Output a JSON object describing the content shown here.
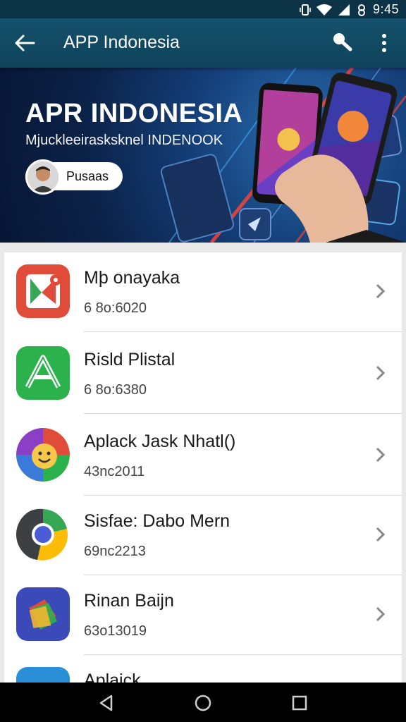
{
  "status_bar": {
    "time": "9:45",
    "icons": [
      "vibrate-icon",
      "wifi-icon",
      "signal-icon",
      "data-icon"
    ]
  },
  "app_bar": {
    "title": "APP Indonesia",
    "icons": [
      "back-arrow-icon",
      "search-icon",
      "more-vert-icon"
    ]
  },
  "banner": {
    "title": "APR INDONESIA",
    "subtitle": "Mjuckleeirasksknel INDENOOK",
    "button_label": "Pusaas",
    "colors": {
      "background": "#0b2146",
      "accent_line": "#e8433a"
    }
  },
  "apps": [
    {
      "name": "Mþ onayaka",
      "sub": "6 8o:6020",
      "icon": "maps-icon",
      "icon_color": "#e04b3a"
    },
    {
      "name": "Risld Plistal",
      "sub": "6 8o:6380",
      "icon": "a-logo-icon",
      "icon_color": "#2bb24c"
    },
    {
      "name": "Aplack Jask Nhatl()",
      "sub": "43nc2011",
      "icon": "emoji-chat-icon",
      "icon_color": "#f2b632"
    },
    {
      "name": "Sisfae: Dabo Mern",
      "sub": "69nc2213",
      "icon": "chrome-icon",
      "icon_color": "#4285f4"
    },
    {
      "name": "Rinan Baijn",
      "sub": "63o13019",
      "icon": "layers-icon",
      "icon_color": "#3a4ab8"
    },
    {
      "name": "Aplaick",
      "sub": "",
      "icon": "people-photo-icon",
      "icon_color": "#2a8fd6"
    }
  ],
  "nav_bar": {
    "icons": [
      "back-triangle-icon",
      "home-circle-icon",
      "recents-square-icon"
    ]
  }
}
